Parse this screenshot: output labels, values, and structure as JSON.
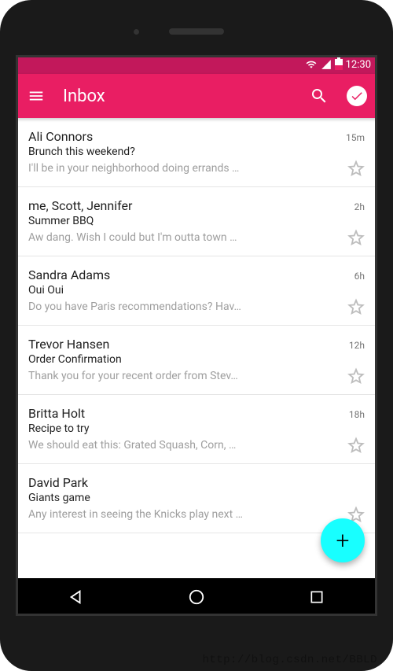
{
  "statusbar": {
    "time": "12:30"
  },
  "appbar": {
    "title": "Inbox"
  },
  "emails": [
    {
      "sender": "Ali Connors",
      "time": "15m",
      "subject": "Brunch this weekend?",
      "preview": "I'll be in your neighborhood doing errands …"
    },
    {
      "sender": "me, Scott, Jennifer",
      "time": "2h",
      "subject": "Summer BBQ",
      "preview": "Aw dang. Wish I could but I'm outta town …"
    },
    {
      "sender": "Sandra Adams",
      "time": "6h",
      "subject": "Oui Oui",
      "preview": "Do you have Paris recommendations? Hav…"
    },
    {
      "sender": "Trevor Hansen",
      "time": "12h",
      "subject": "Order Confirmation",
      "preview": "Thank you for your recent order from Stev…"
    },
    {
      "sender": "Britta Holt",
      "time": "18h",
      "subject": "Recipe to try",
      "preview": "We should eat this: Grated Squash, Corn, …"
    },
    {
      "sender": "David Park",
      "time": "",
      "subject": "Giants game",
      "preview": "Any interest in seeing the Knicks play next …"
    }
  ],
  "fab": {
    "label": "+"
  },
  "watermark": "http://blog.csdn.net/BBLD"
}
